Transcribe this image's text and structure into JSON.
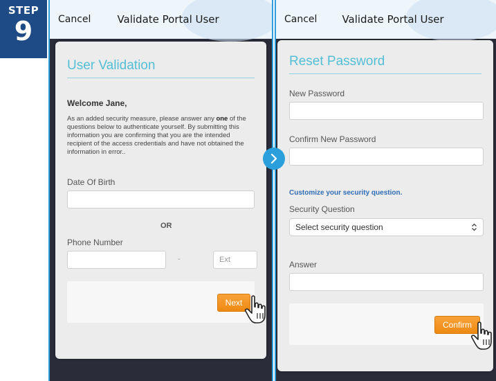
{
  "step": {
    "label": "STEP",
    "number": "9"
  },
  "left": {
    "topbar": {
      "cancel": "Cancel",
      "title": "Validate Portal User"
    },
    "card_title": "User Validation",
    "welcome": "Welcome Jane,",
    "instructions_pre": "As an added security measure, please answer any ",
    "instructions_bold": "one",
    "instructions_post": " of the questions below to authenticate yourself. By submitting this information you are confirming that you are the intended recipient of the access credentials and have not obtained the information in error..",
    "dob_label": "Date Of Birth",
    "dob_value": "",
    "or_text": "OR",
    "phone_label": "Phone Number",
    "phone_value": "",
    "dash": "-",
    "ext_placeholder": "Ext",
    "next_button": "Next"
  },
  "right": {
    "topbar": {
      "cancel": "Cancel",
      "title": "Validate Portal User"
    },
    "card_title": "Reset Password",
    "new_password_label": "New Password",
    "confirm_password_label": "Confirm New Password",
    "customize_heading": "Customize your security question.",
    "security_question_label": "Security Question",
    "security_question_selected": "Select security question",
    "answer_label": "Answer",
    "confirm_button": "Confirm"
  },
  "colors": {
    "accent_blue": "#2b9fdc",
    "badge_blue": "#1e4a86",
    "title_teal": "#52bfd6",
    "button_orange": "#f29418",
    "heading_blue": "#2f6db5"
  },
  "icons": {
    "next_arrow": "chevron-right-icon",
    "pointer": "hand-pointer-icon",
    "select": "select-arrows-icon"
  }
}
